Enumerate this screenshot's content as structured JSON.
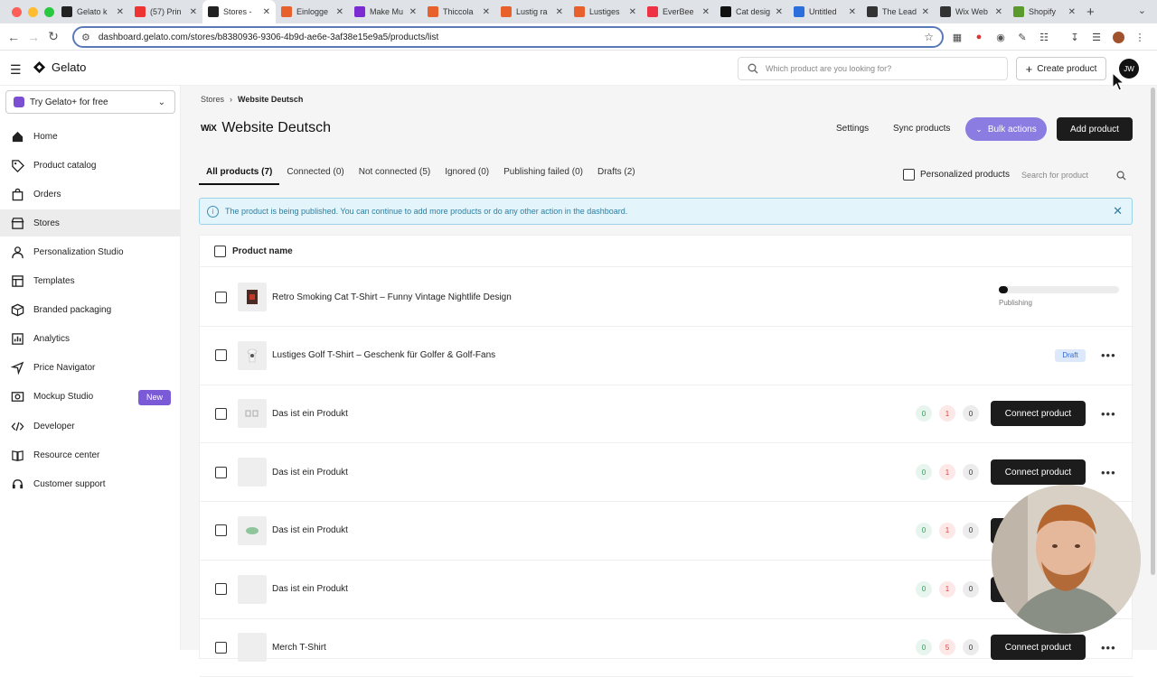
{
  "browser": {
    "tabs": [
      {
        "title": "Gelato k",
        "color": "#222"
      },
      {
        "title": "(57) Prin",
        "color": "#e33"
      },
      {
        "title": "Stores -",
        "color": "#222",
        "active": true
      },
      {
        "title": "Einlogge",
        "color": "#e8602c"
      },
      {
        "title": "Make Mu",
        "color": "#7b2bd1"
      },
      {
        "title": "Thiccola",
        "color": "#e8602c"
      },
      {
        "title": "Lustig ra",
        "color": "#e8602c"
      },
      {
        "title": "Lustiges",
        "color": "#e8602c"
      },
      {
        "title": "EverBee",
        "color": "#e34"
      },
      {
        "title": "Cat desig",
        "color": "#111"
      },
      {
        "title": "Untitled",
        "color": "#2a6fdc"
      },
      {
        "title": "The Lead",
        "color": "#333"
      },
      {
        "title": "Wix Web",
        "color": "#333"
      },
      {
        "title": "Shopify",
        "color": "#5a9a2c"
      }
    ],
    "url": "dashboard.gelato.com/stores/b8380936-9306-4b9d-ae6e-3af38e15e9a5/products/list"
  },
  "header": {
    "logo": "Gelato",
    "search_placeholder": "Which product are you looking for?",
    "create_label": "Create product",
    "avatar": "JW"
  },
  "sidebar": {
    "trial_label": "Try Gelato+ for free",
    "items": [
      {
        "label": "Home",
        "icon": "home-icon"
      },
      {
        "label": "Product catalog",
        "icon": "tag-icon"
      },
      {
        "label": "Orders",
        "icon": "bag-icon"
      },
      {
        "label": "Stores",
        "icon": "store-icon",
        "active": true
      },
      {
        "label": "Personalization Studio",
        "icon": "person-icon"
      },
      {
        "label": "Templates",
        "icon": "template-icon"
      },
      {
        "label": "Branded packaging",
        "icon": "box-icon"
      },
      {
        "label": "Analytics",
        "icon": "chart-icon"
      },
      {
        "label": "Price Navigator",
        "icon": "navigator-icon"
      },
      {
        "label": "Mockup Studio",
        "icon": "mockup-icon",
        "badge": "New"
      },
      {
        "label": "Developer",
        "icon": "code-icon"
      },
      {
        "label": "Resource center",
        "icon": "book-icon"
      },
      {
        "label": "Customer support",
        "icon": "support-icon"
      }
    ]
  },
  "main": {
    "breadcrumb": {
      "root": "Stores",
      "current": "Website Deutsch"
    },
    "platform": "WiX",
    "title": "Website Deutsch",
    "settings": "Settings",
    "sync": "Sync products",
    "bulk": "Bulk actions",
    "add": "Add product",
    "tabs": [
      "All products (7)",
      "Connected (0)",
      "Not connected (5)",
      "Ignored (0)",
      "Publishing failed (0)",
      "Drafts (2)"
    ],
    "personalized_label": "Personalized products",
    "product_search_placeholder": "Search for product",
    "info_message": "The product is being published. You can continue to add more products or do any other action in the dashboard.",
    "column_header": "Product name",
    "connect_label": "Connect product",
    "publishing_label": "Publishing",
    "publishing_progress": 0.05,
    "draft_label": "Draft",
    "rows": [
      {
        "name": "Retro Smoking Cat T-Shirt – Funny Vintage Nightlife Design",
        "status": "publishing"
      },
      {
        "name": "Lustiges Golf T-Shirt – Geschenk für Golfer & Golf-Fans",
        "status": "draft"
      },
      {
        "name": "Das ist ein Produkt",
        "status": "connect",
        "counts": [
          "0",
          "1",
          "0"
        ]
      },
      {
        "name": "Das ist ein Produkt",
        "status": "connect",
        "counts": [
          "0",
          "1",
          "0"
        ]
      },
      {
        "name": "Das ist ein Produkt",
        "status": "connect",
        "counts": [
          "0",
          "1",
          "0"
        ]
      },
      {
        "name": "Das ist ein Produkt",
        "status": "connect",
        "counts": [
          "0",
          "1",
          "0"
        ]
      },
      {
        "name": "Merch T-Shirt",
        "status": "connect",
        "counts": [
          "0",
          "5",
          "0"
        ]
      }
    ]
  }
}
